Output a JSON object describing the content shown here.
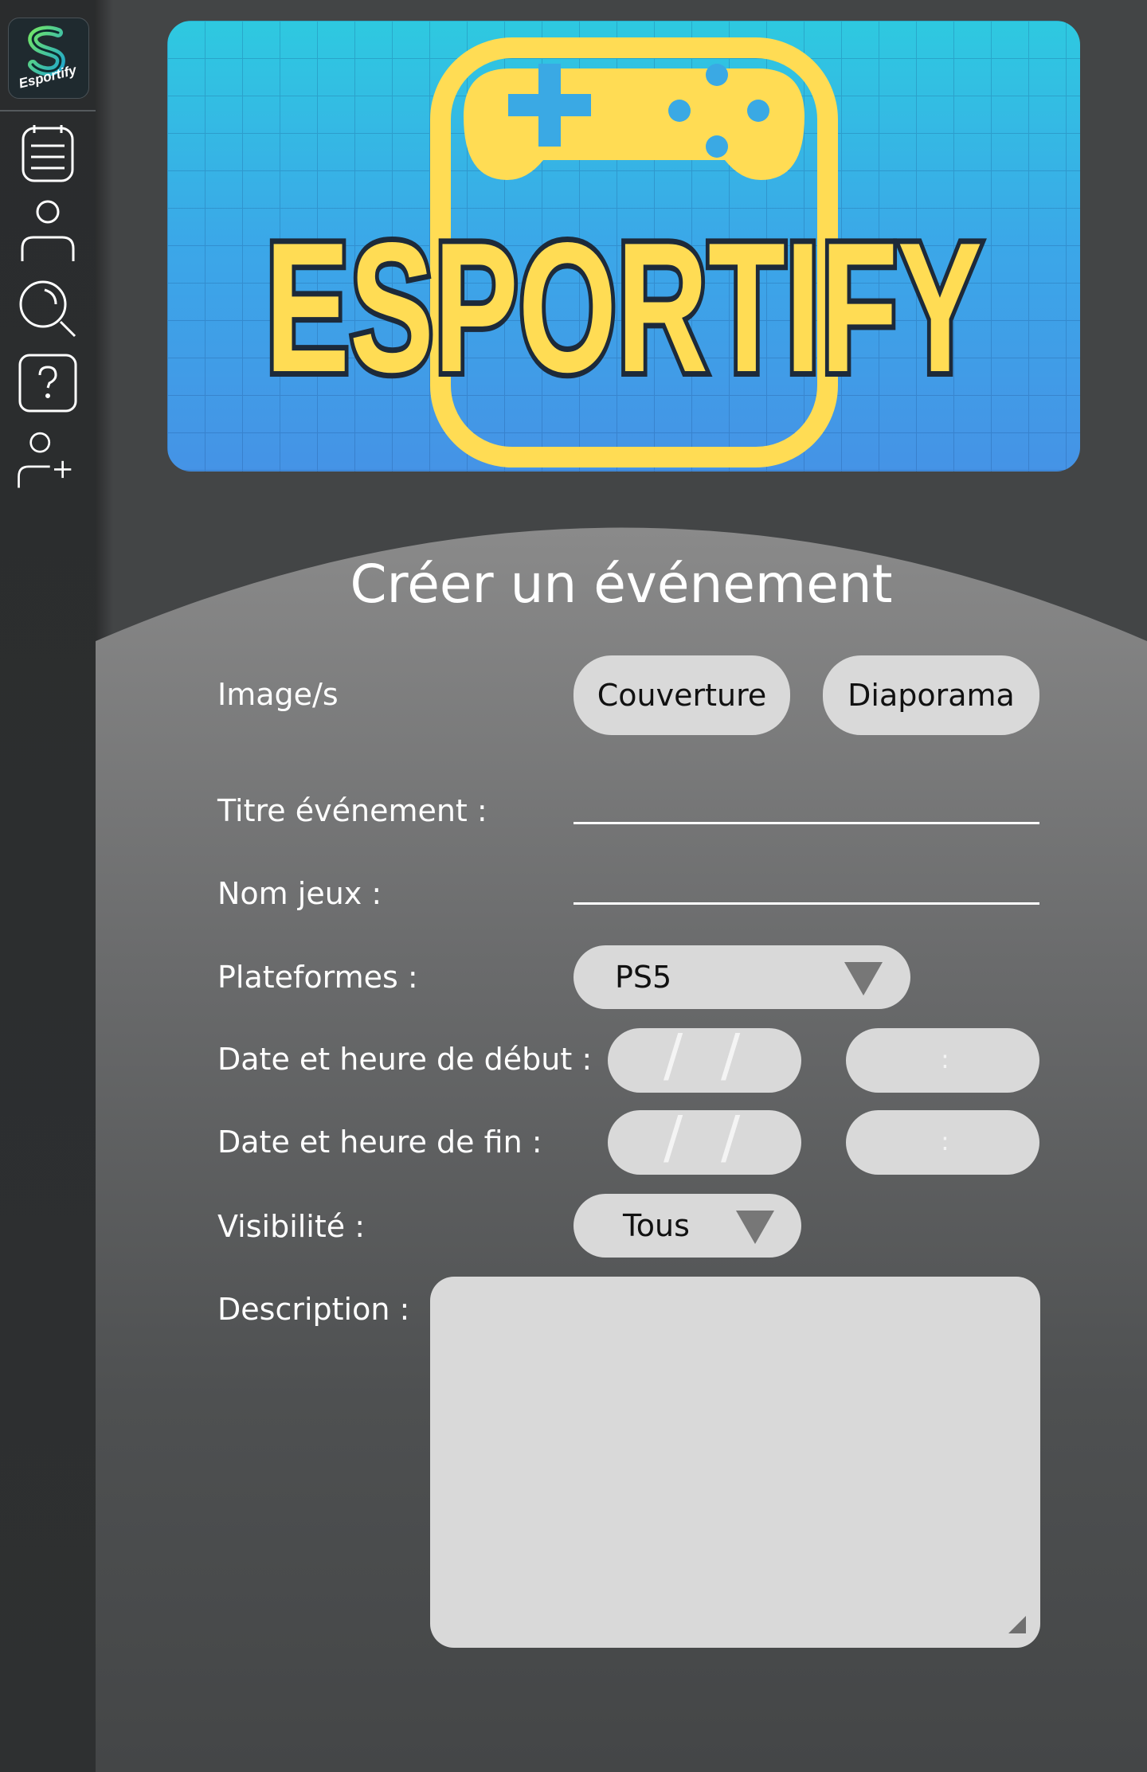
{
  "sidebar": {
    "logo_text": "Esportify",
    "icons": [
      "calendar-list-icon",
      "user-icon",
      "search-icon",
      "help-icon",
      "add-user-icon"
    ]
  },
  "banner": {
    "brand_text": "ESPORTIFY",
    "colors": {
      "bg_top": "#2ec9e0",
      "bg_bottom": "#4593e6",
      "accent": "#ffdc54"
    }
  },
  "form": {
    "title": "Créer un événement",
    "images_label": "Image/s",
    "cover_button": "Couverture",
    "slideshow_button": "Diaporama",
    "event_title_label": "Titre événement :",
    "event_title_value": "",
    "game_name_label": "Nom jeux :",
    "game_name_value": "",
    "platforms_label": "Plateformes :",
    "platform_selected": "PS5",
    "start_label": "Date et heure de début :",
    "end_label": "Date et heure de fin :",
    "visibility_label": "Visibilité :",
    "visibility_selected": "Tous",
    "description_label": "Description :",
    "description_value": ""
  }
}
